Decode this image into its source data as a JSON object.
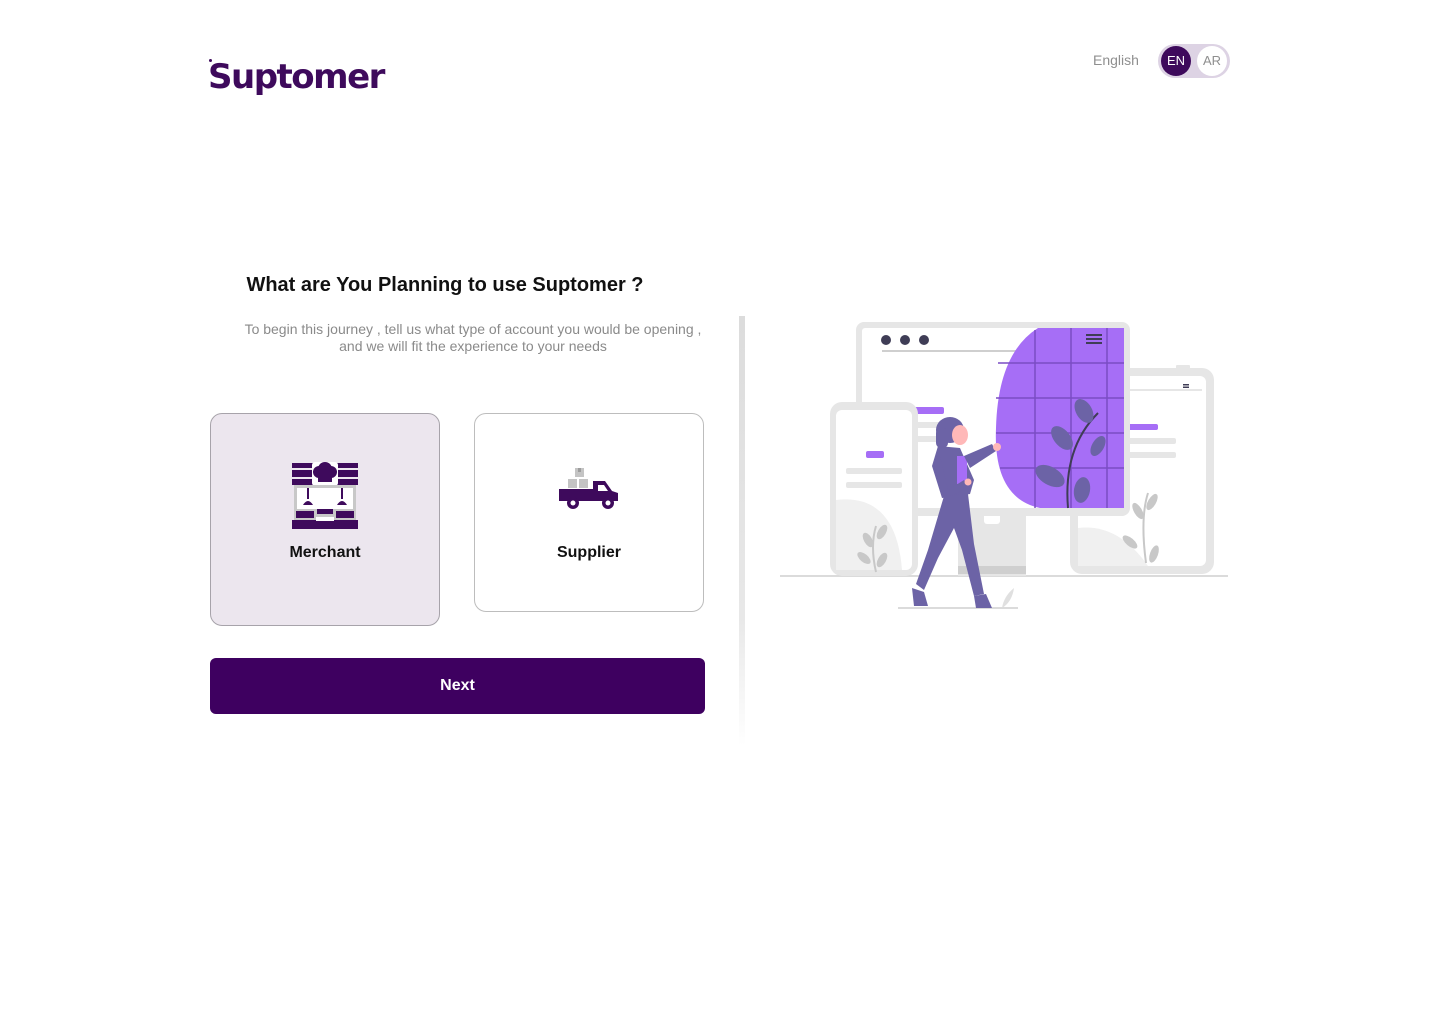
{
  "brand": {
    "logo_text": "Suptomer"
  },
  "language": {
    "label": "English",
    "options": [
      "EN",
      "AR"
    ],
    "selected": "EN"
  },
  "main": {
    "heading": "What are You Planning to use Suptomer ?",
    "subtitle_line1": "To begin this journey , tell us what type of account you would be opening ,",
    "subtitle_line2": "and we will fit the experience to your needs",
    "account_types": [
      {
        "label": "Merchant",
        "icon": "storefront-icon",
        "selected": true
      },
      {
        "label": "Supplier",
        "icon": "delivery-truck-icon",
        "selected": false
      }
    ],
    "next_label": "Next"
  },
  "colors": {
    "brand_purple": "#3e0a5c",
    "button_purple": "#3e0060",
    "accent_violet": "#a66ef6",
    "figure_purple": "#6c63a6",
    "selected_card_bg": "#ece6ee"
  }
}
